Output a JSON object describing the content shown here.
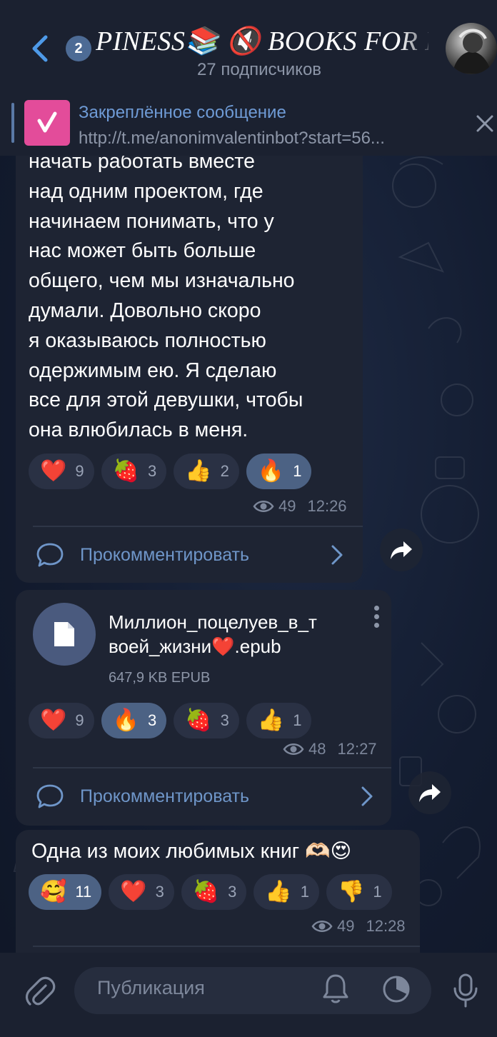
{
  "header": {
    "unread_count": "2",
    "title": "PINESS📚 🔇   BOOKS FOR M",
    "subscribers": "27 подписчиков"
  },
  "pinned": {
    "title": "Закреплённое сообщение",
    "text": "http://t.me/anonimvalentinbot?start=56..."
  },
  "messages": [
    {
      "lines": [
        "начать работать вместе",
        "над одним проектом, где",
        "начинаем понимать, что у",
        "нас может быть больше",
        "общего, чем мы изначально",
        "думали. Довольно скоро",
        "я оказываюсь полностью",
        "одержимым ею. Я сделаю",
        "все для этой девушки, чтобы",
        "она влюбилась в меня."
      ],
      "reactions": [
        {
          "emoji": "❤️",
          "count": "9",
          "active": false
        },
        {
          "emoji": "🍓",
          "count": "3",
          "active": false
        },
        {
          "emoji": "👍",
          "count": "2",
          "active": false
        },
        {
          "emoji": "🔥",
          "count": "1",
          "active": true
        }
      ],
      "views": "49",
      "time": "12:26",
      "comment_label": "Прокомментировать"
    },
    {
      "file_name_line1": "Миллион_поцелуев_в_т",
      "file_name_line2": "воей_жизни❤️.epub",
      "file_size": "647,9 KB EPUB",
      "reactions": [
        {
          "emoji": "❤️",
          "count": "9",
          "active": false
        },
        {
          "emoji": "🔥",
          "count": "3",
          "active": true
        },
        {
          "emoji": "🍓",
          "count": "3",
          "active": false
        },
        {
          "emoji": "👍",
          "count": "1",
          "active": false
        }
      ],
      "views": "48",
      "time": "12:27",
      "comment_label": "Прокомментировать"
    },
    {
      "text": "Одна из моих любимых книг 🫶🏻😍",
      "reactions": [
        {
          "emoji": "🥰",
          "count": "11",
          "active": true
        },
        {
          "emoji": "❤️",
          "count": "3",
          "active": false
        },
        {
          "emoji": "🍓",
          "count": "3",
          "active": false
        },
        {
          "emoji": "👍",
          "count": "1",
          "active": false
        },
        {
          "emoji": "👎",
          "count": "1",
          "active": false
        }
      ],
      "views": "49",
      "time": "12:28"
    }
  ],
  "composer": {
    "placeholder": "Публикация"
  },
  "icons": {
    "back": "back-arrow-icon",
    "mute": "muted-speaker-icon",
    "close": "close-icon",
    "comment": "comment-bubble-icon",
    "share": "share-arrow-icon",
    "file": "document-icon",
    "attach": "paperclip-icon",
    "bell": "bell-icon",
    "timer": "timer-icon",
    "mic": "microphone-icon"
  },
  "colors": {
    "accent": "#6f96c9",
    "bubble": "#1e2433",
    "active_chip": "#4c6284"
  }
}
